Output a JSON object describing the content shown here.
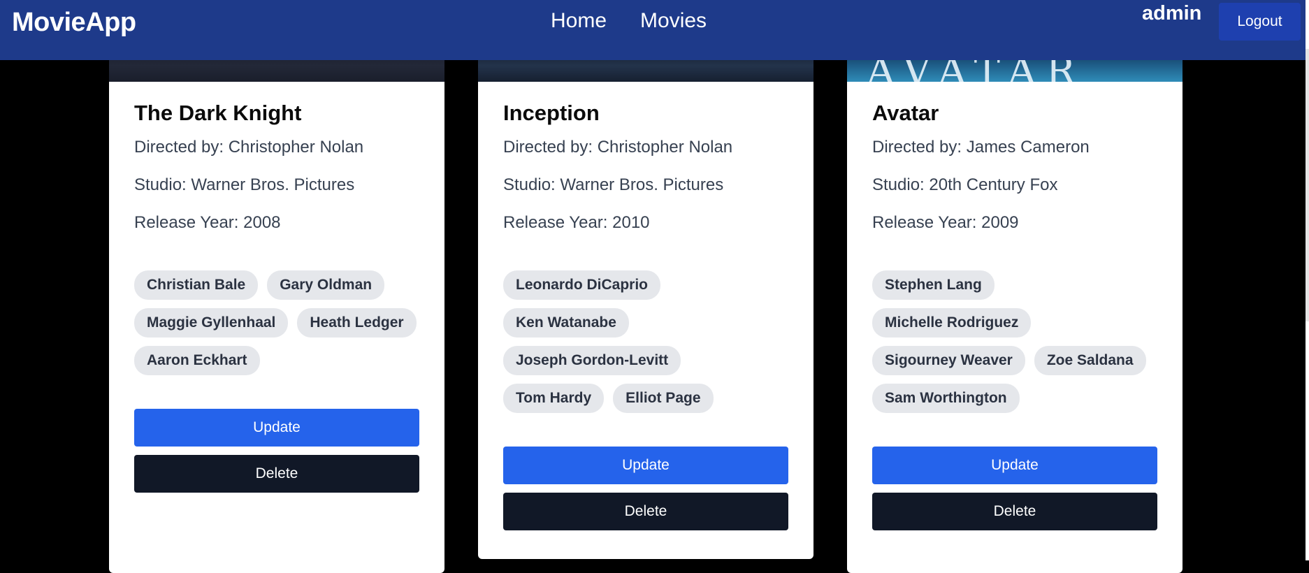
{
  "navbar": {
    "brand": "MovieApp",
    "links": [
      "Home",
      "Movies"
    ],
    "username": "admin",
    "logout_label": "Logout"
  },
  "colors": {
    "navbar_bg": "#1e3a8a",
    "update_button": "#2563eb",
    "delete_button": "#111827",
    "tag_bg": "#e5e7eb",
    "page_bg": "#000000"
  },
  "movies": [
    {
      "title": "The Dark Knight",
      "director_line": "Directed by: Christopher Nolan",
      "studio_line": "Studio: Warner Bros. Pictures",
      "year_line": "Release Year: 2008",
      "actors": [
        "Christian Bale",
        "Gary Oldman",
        "Maggie Gyllenhaal",
        "Heath Ledger",
        "Aaron Eckhart"
      ],
      "update_label": "Update",
      "delete_label": "Delete"
    },
    {
      "title": "Inception",
      "director_line": "Directed by: Christopher Nolan",
      "studio_line": "Studio: Warner Bros. Pictures",
      "year_line": "Release Year: 2010",
      "actors": [
        "Leonardo DiCaprio",
        "Ken Watanabe",
        "Joseph Gordon-Levitt",
        "Tom Hardy",
        "Elliot Page"
      ],
      "update_label": "Update",
      "delete_label": "Delete"
    },
    {
      "title": "Avatar",
      "director_line": "Directed by: James Cameron",
      "studio_line": "Studio: 20th Century Fox",
      "year_line": "Release Year: 2009",
      "poster_text": "AVATAR",
      "actors": [
        "Stephen Lang",
        "Michelle Rodriguez",
        "Sigourney Weaver",
        "Zoe Saldana",
        "Sam Worthington"
      ],
      "update_label": "Update",
      "delete_label": "Delete"
    }
  ]
}
